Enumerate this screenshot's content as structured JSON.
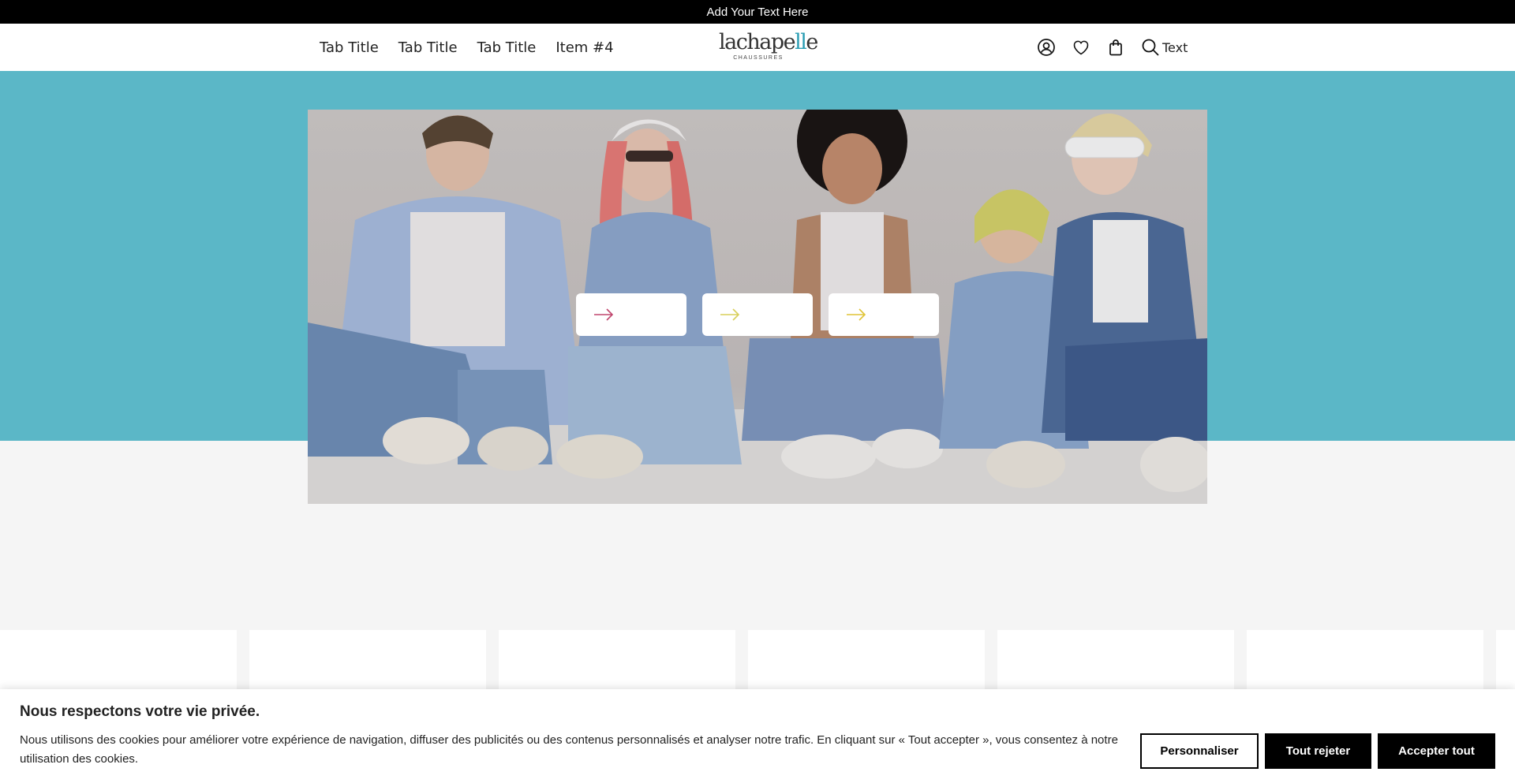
{
  "announcement": {
    "text": "Add Your Text Here"
  },
  "header": {
    "nav": [
      "Tab Title",
      "Tab Title",
      "Tab Title",
      "Item #4"
    ],
    "logo": {
      "main_a": "lacha",
      "main_b": "pe",
      "main_c": "ll",
      "main_d": "e",
      "sub": "CHAUSSURES"
    },
    "icons": [
      "account-icon",
      "heart-icon",
      "bag-icon",
      "search-icon"
    ],
    "search_label": "Text"
  },
  "hero": {
    "background_color": "#5bb7c7",
    "buttons": [
      {
        "icon": "arrow-right-icon",
        "color": "#c0476e"
      },
      {
        "icon": "arrow-right-icon",
        "color": "#d8cf5a"
      },
      {
        "icon": "arrow-right-icon",
        "color": "#e0c437"
      }
    ]
  },
  "cookie_banner": {
    "title": "Nous respectons votre vie privée.",
    "body": "Nous utilisons des cookies pour améliorer votre expérience de navigation, diffuser des publicités ou des contenus personnalisés et analyser notre trafic. En cliquant sur « Tout accepter », vous consentez à notre utilisation des cookies.",
    "customize_label": "Personnaliser",
    "reject_label": "Tout rejeter",
    "accept_label": "Accepter tout"
  }
}
